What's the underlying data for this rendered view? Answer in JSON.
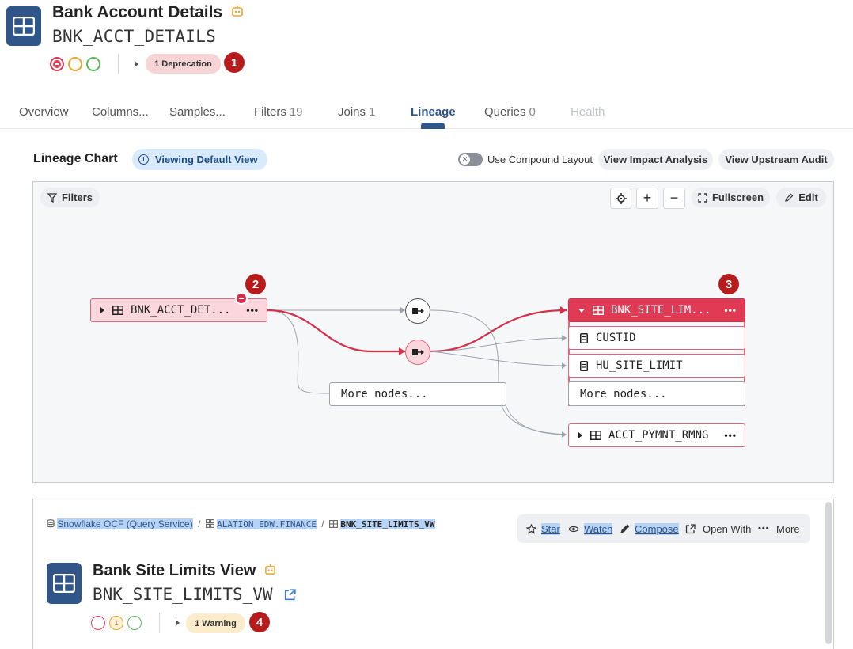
{
  "header": {
    "title": "Bank Account Details",
    "subtitle": "BNK_ACCT_DETAILS",
    "deprecation_label": "1 Deprecation",
    "badge_1": "1"
  },
  "tabs": [
    {
      "label": "Overview",
      "count": ""
    },
    {
      "label": "Columns...",
      "count": ""
    },
    {
      "label": "Samples...",
      "count": ""
    },
    {
      "label": "Filters",
      "count": "19"
    },
    {
      "label": "Joins",
      "count": "1"
    },
    {
      "label": "Lineage",
      "count": ""
    },
    {
      "label": "Queries",
      "count": "0"
    },
    {
      "label": "Health",
      "count": ""
    }
  ],
  "lineage_toolbar": {
    "title": "Lineage Chart",
    "view_label": "Viewing Default View",
    "toggle_label": "Use Compound Layout",
    "impact_label": "View Impact Analysis",
    "audit_label": "View Upstream Audit"
  },
  "chart_controls": {
    "filters_label": "Filters",
    "zoom_in": "+",
    "zoom_out": "−",
    "fullscreen_label": "Fullscreen",
    "edit_label": "Edit"
  },
  "graph": {
    "source_node": "BNK_ACCT_DET...",
    "badge_2": "2",
    "target_node": "BNK_SITE_LIM...",
    "badge_3": "3",
    "columns": [
      "CUSTID",
      "HU_SITE_LIMIT"
    ],
    "more_nodes_center": "More nodes...",
    "more_nodes_right": "More nodes...",
    "bottom_node": "ACCT_PYMNT_RMNG"
  },
  "panel": {
    "breadcrumb": {
      "source": "Snowflake OCF (Query Service)",
      "sep1": "/",
      "schema": "ALATION_EDW.FINANCE",
      "sep2": "/",
      "table": "BNK_SITE_LIMITS_VW"
    },
    "actions": {
      "star": "Star",
      "watch": "Watch",
      "compose": "Compose",
      "open_with": "Open With",
      "more": "More"
    },
    "title": "Bank Site Limits View",
    "subtitle": "BNK_SITE_LIMITS_VW",
    "warning_label": "1 Warning",
    "warning_count": "1",
    "badge_4": "4"
  },
  "colors": {
    "brand": "#2f5589",
    "deprecated_red": "#e03a55",
    "badge_red": "#b71c1c",
    "warning_yellow": "#e8a72a",
    "ok_green": "#5cb85c"
  }
}
